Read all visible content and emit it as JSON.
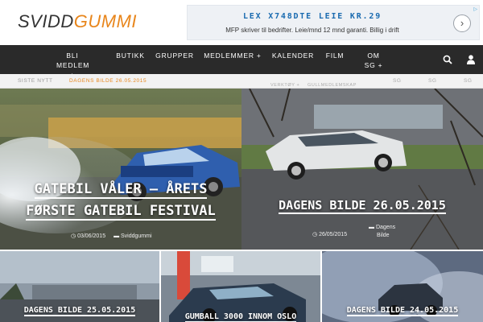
{
  "logo": {
    "part1": "SVIDD",
    "part2": "GUMMI"
  },
  "ad": {
    "title": "LEX X748DTE LEIE KR.29",
    "text": "MFP skriver til bedrifter. Leie/mnd 12 mnd garanti. Billig i drift",
    "button": "›",
    "badge": "▷"
  },
  "nav": {
    "items": [
      {
        "line1": "BLI",
        "line2": "MEDLEM +"
      },
      {
        "line1": "BUTIKK",
        "line2": ""
      },
      {
        "line1": "GRUPPER",
        "line2": ""
      },
      {
        "line1": "MEDLEMMER +",
        "line2": ""
      },
      {
        "line1": "KALENDER",
        "line2": ""
      },
      {
        "line1": "FILM",
        "line2": ""
      },
      {
        "line1": "OM",
        "line2": "SG +"
      }
    ],
    "search_icon": "search-icon",
    "user_icon": "user-icon"
  },
  "subbar": {
    "label": "SISTE NYTT",
    "latest": "DAGENS BILDE 26.05.2015",
    "links": [
      "VERKTØY +",
      "GULLMEDLEMSKAP",
      "SG",
      "SG",
      "SG"
    ]
  },
  "tiles": [
    {
      "title_line1": "GATEBIL VÅLER – ÅRETS",
      "title_line2": "FØRSTE GATEBIL FESTIVAL",
      "date": "03/06/2015",
      "category": "Sviddgummi"
    },
    {
      "title_line1": "DAGENS BILDE 26.05.2015",
      "date": "26/05/2015",
      "category_line1": "Dagens",
      "category_line2": "Bilde"
    },
    {
      "title_line1": "DAGENS BILDE 25.05.2015"
    },
    {
      "title_line1": "GUMBALL 3000 INNOM OSLO"
    },
    {
      "title_line1": "DAGENS BILDE 24.05.2015"
    }
  ],
  "colors": {
    "brand_orange": "#e8861c",
    "nav_bg": "#2a2a2a",
    "ad_blue": "#1a6bb0"
  }
}
